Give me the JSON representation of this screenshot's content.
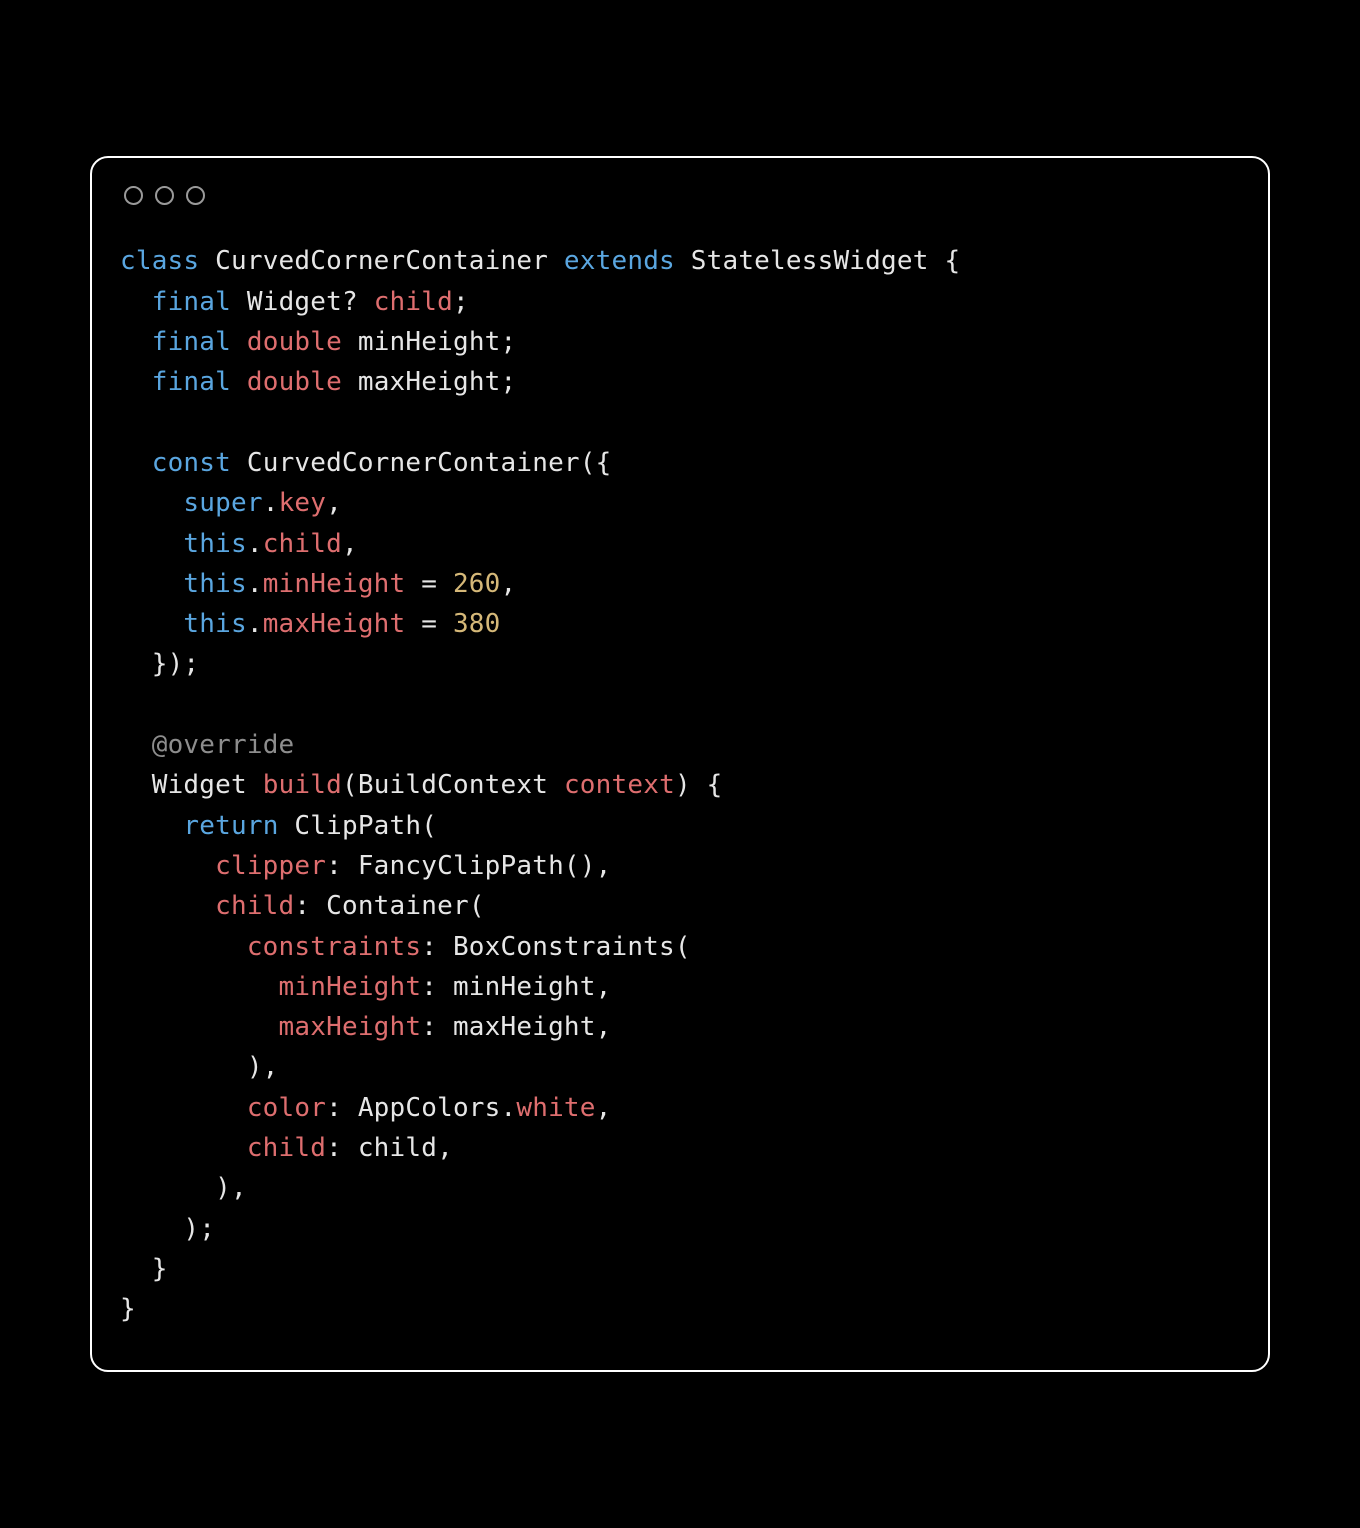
{
  "code": {
    "tokens": {
      "t01": "class",
      "t02": "CurvedCornerContainer",
      "t03": "extends",
      "t04": "StatelessWidget",
      "t05": "{",
      "t06": "final",
      "t07": "Widget",
      "t08": "?",
      "t09": "child",
      "t10": ";",
      "t11": "final",
      "t12": "double",
      "t13": "minHeight",
      "t14": ";",
      "t15": "final",
      "t16": "double",
      "t17": "maxHeight",
      "t18": ";",
      "t20": "const",
      "t21": "CurvedCornerContainer",
      "t22": "({",
      "t23": "super",
      "t24": ".",
      "t25": "key",
      "t26": ",",
      "t27": "this",
      "t28": ".",
      "t29": "child",
      "t30": ",",
      "t31": "this",
      "t32": ".",
      "t33": "minHeight",
      "t34": " = ",
      "t35": "260",
      "t36": ",",
      "t37": "this",
      "t38": ".",
      "t39": "maxHeight",
      "t40": " = ",
      "t41": "380",
      "t43": "});",
      "t50": "@override",
      "t51": "Widget",
      "t52": "build",
      "t53": "(",
      "t54": "BuildContext",
      "t55": "context",
      "t56": ") {",
      "t57": "return",
      "t58": "ClipPath",
      "t59": "(",
      "t60": "clipper",
      "t61": ": ",
      "t62": "FancyClipPath",
      "t63": "(),",
      "t64": "child",
      "t65": ": ",
      "t66": "Container",
      "t67": "(",
      "t68": "constraints",
      "t69": ": ",
      "t70": "BoxConstraints",
      "t71": "(",
      "t72": "minHeight",
      "t73": ": ",
      "t74": "minHeight",
      "t75": ",",
      "t76": "maxHeight",
      "t77": ": ",
      "t78": "maxHeight",
      "t79": ",",
      "t80": "),",
      "t81": "color",
      "t82": ": ",
      "t83": "AppColors",
      "t84": ".",
      "t85": "white",
      "t86": ",",
      "t87": "child",
      "t88": ": ",
      "t89": "child",
      "t90": ",",
      "t91": "),",
      "t92": ");",
      "t93": "}",
      "t94": "}"
    }
  },
  "theme": {
    "background": "#000000",
    "keyword": "#5aa6e0",
    "identifier": "#de6e6f",
    "number": "#d5b878",
    "annotation": "#8d8d8d",
    "default": "#e6e6e6"
  }
}
